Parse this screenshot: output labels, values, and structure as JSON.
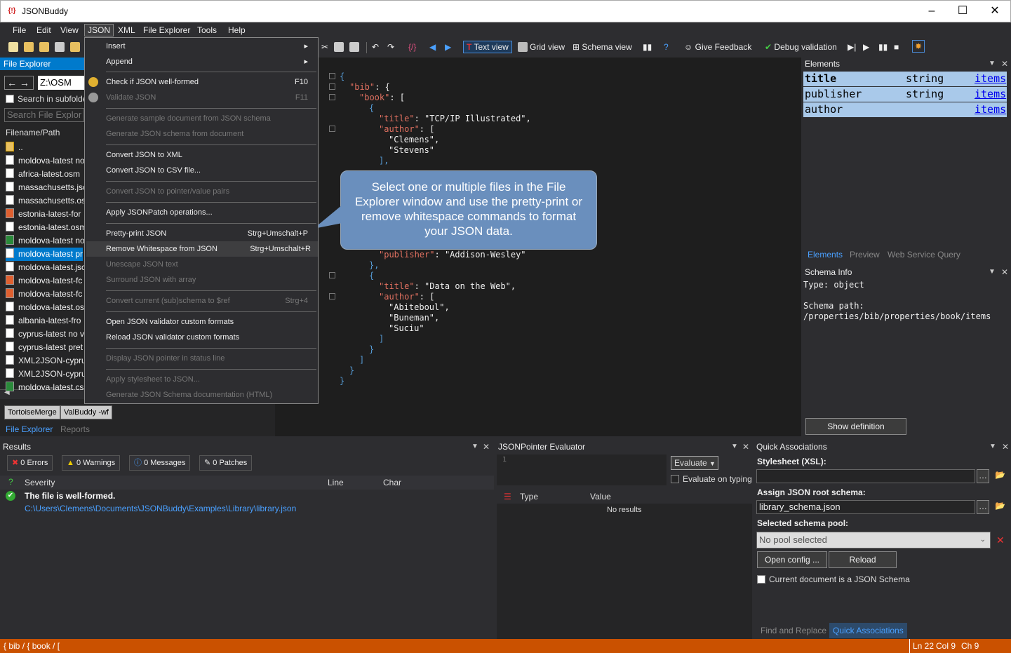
{
  "app": {
    "title": "JSONBuddy"
  },
  "window": {
    "minimize": "–",
    "maximize": "☐",
    "close": "✕"
  },
  "menubar": [
    "File",
    "Edit",
    "View",
    "JSON",
    "XML",
    "File Explorer",
    "Tools",
    "Help"
  ],
  "toolbar": {
    "text_view": "Text view",
    "grid_view": "Grid view",
    "schema_view": "Schema view",
    "give_feedback": "Give Feedback",
    "debug_validation": "Debug validation"
  },
  "file_explorer": {
    "title": "File Explorer",
    "path": "Z:\\OSM",
    "search_subfolders": "Search in subfolders",
    "search_placeholder": "Search File Explor",
    "column": "Filename/Path",
    "up": "..",
    "files": [
      "moldova-latest no",
      "africa-latest.osm",
      "massachusetts.jsc",
      "massachusetts.os",
      "estonia-latest-for",
      "estonia-latest.osm",
      "moldova-latest no",
      "moldova-latest pr",
      "moldova-latest.jsc",
      "moldova-latest-fc",
      "moldova-latest-fc",
      "moldova-latest.os",
      "albania-latest-fro",
      "cyprus-latest no v",
      "cyprus-latest pret",
      "XML2JSON-cypru",
      "XML2JSON-cypru",
      "moldova-latest.cs"
    ],
    "bottom_tabs": [
      "TortoiseMerge",
      "ValBuddy -wf"
    ],
    "panel_tabs": [
      "File Explorer",
      "Reports"
    ]
  },
  "json_menu": {
    "insert": "Insert",
    "append": "Append",
    "check": "Check if JSON well-formed",
    "check_sc": "F10",
    "validate": "Validate JSON",
    "validate_sc": "F11",
    "gen_sample": "Generate sample document from JSON schema",
    "gen_schema": "Generate JSON schema from document",
    "to_xml": "Convert JSON to XML",
    "to_csv": "Convert JSON to CSV file...",
    "to_pointer": "Convert JSON to pointer/value pairs",
    "patch": "Apply JSONPatch operations...",
    "pretty": "Pretty-print JSON",
    "pretty_sc": "Strg+Umschalt+P",
    "remove_ws": "Remove Whitespace from JSON",
    "remove_ws_sc": "Strg+Umschalt+R",
    "unescape": "Unescape JSON text",
    "surround": "Surround JSON with array",
    "convert_ref": "Convert current (sub)schema to $ref",
    "convert_ref_sc": "Strg+4",
    "open_custom": "Open JSON validator custom formats",
    "reload_custom": "Reload JSON validator custom formats",
    "display_pointer": "Display JSON pointer in status line",
    "stylesheet": "Apply stylesheet to JSON...",
    "gen_doc": "Generate JSON Schema documentation (HTML)"
  },
  "editor": {
    "lines": [
      [
        "{",
        "",
        ""
      ],
      [
        "\"bib\"",
        ": {",
        ""
      ],
      [
        "\"book\"",
        ": [",
        ""
      ],
      [
        "{",
        "",
        ""
      ],
      [
        "\"title\"",
        ": ",
        "\"TCP/IP Illustrated\","
      ],
      [
        "\"author\"",
        ": [",
        ""
      ],
      [
        "",
        "",
        "\"Clemens\","
      ],
      [
        "",
        "",
        "\"Stevens\""
      ],
      [
        "],",
        "",
        ""
      ],
      [
        "\"publisher\"",
        ": ",
        "\"Addison-Wesley\""
      ]
    ],
    "lower": [
      [
        "\"publisher\"",
        ": ",
        "\"Addison-Wesley\""
      ],
      [
        "},",
        "",
        ""
      ],
      [
        "{",
        "",
        ""
      ],
      [
        "\"title\"",
        ": ",
        "\"Data on the Web\","
      ],
      [
        "\"author\"",
        ": [",
        ""
      ],
      [
        "",
        "",
        "\"Abiteboul\","
      ],
      [
        "",
        "",
        "\"Buneman\","
      ],
      [
        "",
        "",
        "\"Suciu\""
      ],
      [
        "]",
        "",
        ""
      ],
      [
        "}",
        "",
        ""
      ],
      [
        "]",
        "",
        ""
      ],
      [
        "}",
        "",
        ""
      ],
      [
        "}",
        "",
        ""
      ]
    ]
  },
  "callout": "Select one or multiple files in the File Explorer window and use the pretty-print or remove whitespace commands to format your JSON data.",
  "elements": {
    "title": "Elements",
    "rows": [
      {
        "name": "title",
        "type": "string",
        "link": "items"
      },
      {
        "name": "publisher",
        "type": "string",
        "link": "items"
      },
      {
        "name": "author",
        "type": "",
        "link": "items"
      }
    ],
    "tabs": [
      "Elements",
      "Preview",
      "Web Service Query"
    ]
  },
  "schema_info": {
    "title": "Schema Info",
    "type_line": "Type: object",
    "path_label": "Schema path:",
    "path": "/properties/bib/properties/book/items",
    "button": "Show definition"
  },
  "results": {
    "title": "Results",
    "errors": "0 Errors",
    "warnings": "0 Warnings",
    "messages": "0 Messages",
    "patches": "0 Patches",
    "col_severity": "Severity",
    "col_line": "Line",
    "col_char": "Char",
    "msg": "The file is well-formed.",
    "file": "C:\\Users\\Clemens\\Documents\\JSONBuddy\\Examples\\Library\\library.json"
  },
  "jsonpointer": {
    "title": "JSONPointer Evaluator",
    "line_no": "1",
    "evaluate": "Evaluate",
    "on_typing": "Evaluate on typing",
    "col_type": "Type",
    "col_value": "Value",
    "empty": "No results"
  },
  "quick_assoc": {
    "title": "Quick Associations",
    "stylesheet_label": "Stylesheet (XSL):",
    "stylesheet_value": "",
    "root_schema_label": "Assign JSON root schema:",
    "root_schema_value": "library_schema.json",
    "pool_label": "Selected schema pool:",
    "pool_value": "No pool selected",
    "open_config": "Open config ...",
    "reload": "Reload",
    "is_schema": "Current document is a JSON Schema",
    "tabs": [
      "Find and Replace",
      "Quick Associations"
    ]
  },
  "status": {
    "path": "{ bib / { book / [",
    "ln": "Ln 22",
    "col": "Col 9",
    "ch": "Ch 9"
  }
}
